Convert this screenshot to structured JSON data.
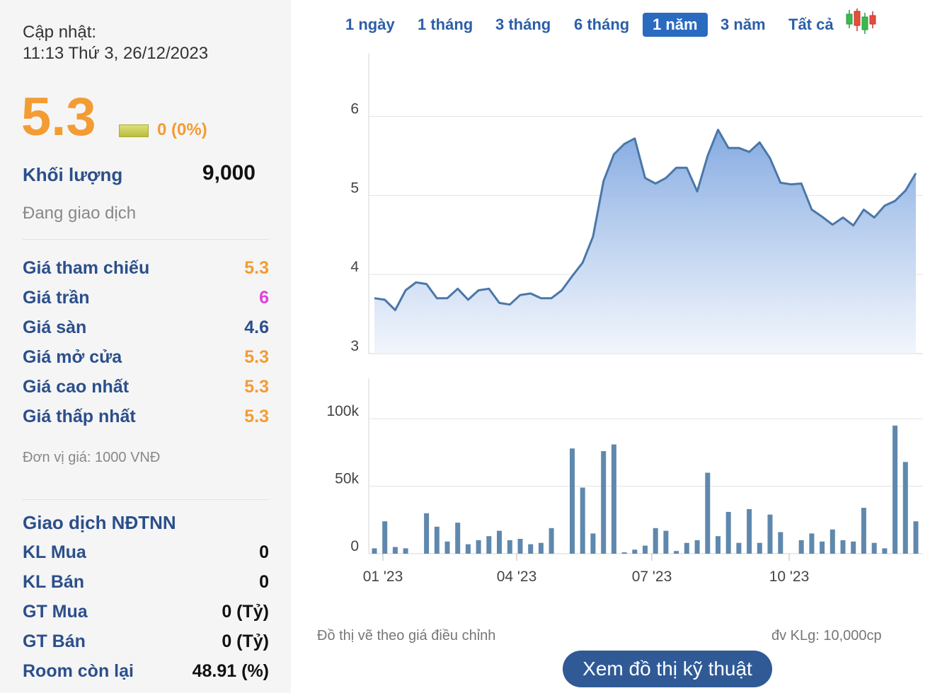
{
  "panel": {
    "update_label": "Cập nhật:",
    "update_time": "11:13 Thứ 3, 26/12/2023",
    "price": "5.3",
    "change": "0 (0%)",
    "volume_label": "Khối lượng",
    "volume_value": "9,000",
    "status": "Đang giao dịch",
    "rows": [
      {
        "label": "Giá tham chiếu",
        "value": "5.3",
        "color": "#f39c34"
      },
      {
        "label": "Giá trần",
        "value": "6",
        "color": "#e040e0"
      },
      {
        "label": "Giá sàn",
        "value": "4.6",
        "color": "#2b4f8b"
      },
      {
        "label": "Giá mở cửa",
        "value": "5.3",
        "color": "#f39c34"
      },
      {
        "label": "Giá cao nhất",
        "value": "5.3",
        "color": "#f39c34"
      },
      {
        "label": "Giá thấp nhất",
        "value": "5.3",
        "color": "#f39c34"
      }
    ],
    "unit_note": "Đơn vị giá: 1000 VNĐ",
    "foreign_title": "Giao dịch NĐTNN",
    "foreign_rows": [
      {
        "label": "KL Mua",
        "value": "0"
      },
      {
        "label": "KL Bán",
        "value": "0"
      },
      {
        "label": "GT Mua",
        "value": "0 (Tỷ)"
      },
      {
        "label": "GT Bán",
        "value": "0 (Tỷ)"
      },
      {
        "label": "Room còn lại",
        "value": "48.91 (%)"
      }
    ]
  },
  "tabs": [
    {
      "label": "1 ngày",
      "active": false
    },
    {
      "label": "1 tháng",
      "active": false
    },
    {
      "label": "3 tháng",
      "active": false
    },
    {
      "label": "6 tháng",
      "active": false
    },
    {
      "label": "1 năm",
      "active": true
    },
    {
      "label": "3 năm",
      "active": false
    },
    {
      "label": "Tất cả",
      "active": false
    }
  ],
  "icons": {
    "candlestick": "candlestick-chart-icon"
  },
  "chart_data": [
    {
      "type": "area",
      "title": "",
      "xlabel": "",
      "ylabel": "",
      "ylim": [
        3,
        6.8
      ],
      "yticks": [
        "3",
        "4",
        "5",
        "6"
      ],
      "grid": true,
      "color": "#4b77a8",
      "values": [
        3.7,
        3.68,
        3.55,
        3.8,
        3.9,
        3.88,
        3.7,
        3.7,
        3.82,
        3.68,
        3.8,
        3.82,
        3.64,
        3.62,
        3.74,
        3.76,
        3.7,
        3.7,
        3.8,
        3.98,
        4.15,
        4.48,
        5.18,
        5.52,
        5.65,
        5.72,
        5.22,
        5.15,
        5.22,
        5.35,
        5.35,
        5.05,
        5.5,
        5.83,
        5.6,
        5.6,
        5.55,
        5.67,
        5.47,
        5.16,
        5.14,
        5.15,
        4.82,
        4.73,
        4.63,
        4.72,
        4.62,
        4.82,
        4.72,
        4.87,
        4.93,
        5.06,
        5.28
      ]
    },
    {
      "type": "bar",
      "title": "",
      "ylim": [
        0,
        130000
      ],
      "yticks": [
        "0",
        "50k",
        "100k"
      ],
      "x_ticks": [
        "01 '23",
        "04 '23",
        "07 '23",
        "10 '23"
      ],
      "color": "#5f88ad",
      "values": [
        4000,
        24000,
        5000,
        4000,
        0,
        30000,
        20000,
        9000,
        23000,
        7000,
        10000,
        13000,
        17000,
        10000,
        11000,
        7000,
        8000,
        19000,
        0,
        78000,
        49000,
        15000,
        76000,
        81000,
        1000,
        3000,
        6000,
        19000,
        17000,
        2000,
        8000,
        10000,
        60000,
        13000,
        31000,
        8000,
        33000,
        8000,
        29000,
        16000,
        0,
        10000,
        15000,
        9000,
        18000,
        10000,
        9000,
        34000,
        8000,
        4000,
        95000,
        68000,
        24000
      ]
    }
  ],
  "notes": {
    "left": "Đồ thị vẽ theo giá điều chỉnh",
    "right": "đv KLg: 10,000cp"
  },
  "button": {
    "label": "Xem đồ thị kỹ thuật"
  }
}
